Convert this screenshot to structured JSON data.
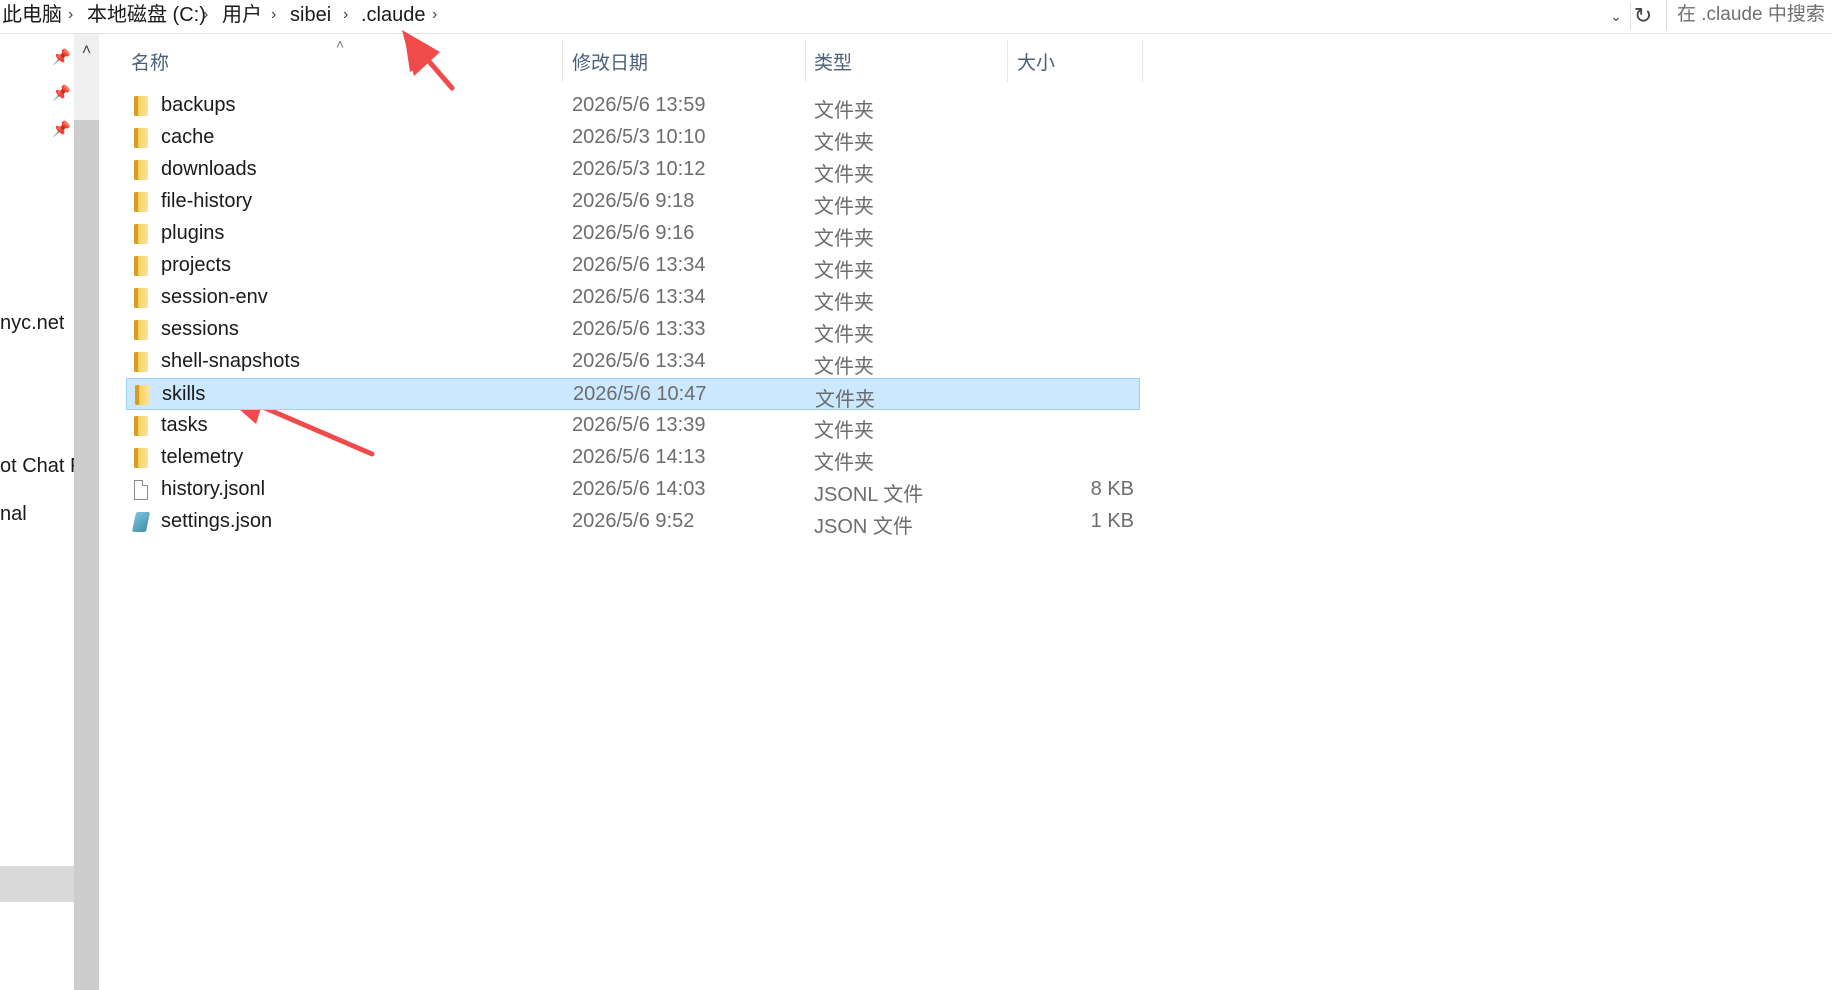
{
  "breadcrumb": {
    "items": [
      "此电脑",
      "本地磁盘 (C:)",
      "用户",
      "sibei",
      ".claude"
    ],
    "separator": "›",
    "trailing_chevron": "›"
  },
  "search": {
    "placeholder": "在 .claude 中搜索"
  },
  "nav": {
    "partial_items": [
      "nyc.net",
      "ot Chat F",
      "nal"
    ]
  },
  "columns": {
    "name": "名称",
    "date": "修改日期",
    "type": "类型",
    "size": "大小"
  },
  "files": [
    {
      "name": "backups",
      "date": "2026/5/6 13:59",
      "type": "文件夹",
      "size": "",
      "icon": "folder-icon"
    },
    {
      "name": "cache",
      "date": "2026/5/3 10:10",
      "type": "文件夹",
      "size": "",
      "icon": "folder-icon"
    },
    {
      "name": "downloads",
      "date": "2026/5/3 10:12",
      "type": "文件夹",
      "size": "",
      "icon": "folder-icon"
    },
    {
      "name": "file-history",
      "date": "2026/5/6 9:18",
      "type": "文件夹",
      "size": "",
      "icon": "folder-icon"
    },
    {
      "name": "plugins",
      "date": "2026/5/6 9:16",
      "type": "文件夹",
      "size": "",
      "icon": "folder-icon"
    },
    {
      "name": "projects",
      "date": "2026/5/6 13:34",
      "type": "文件夹",
      "size": "",
      "icon": "folder-icon"
    },
    {
      "name": "session-env",
      "date": "2026/5/6 13:34",
      "type": "文件夹",
      "size": "",
      "icon": "folder-icon"
    },
    {
      "name": "sessions",
      "date": "2026/5/6 13:33",
      "type": "文件夹",
      "size": "",
      "icon": "folder-icon"
    },
    {
      "name": "shell-snapshots",
      "date": "2026/5/6 13:34",
      "type": "文件夹",
      "size": "",
      "icon": "folder-icon"
    },
    {
      "name": "skills",
      "date": "2026/5/6 10:47",
      "type": "文件夹",
      "size": "",
      "icon": "folder-icon",
      "selected": true
    },
    {
      "name": "tasks",
      "date": "2026/5/6 13:39",
      "type": "文件夹",
      "size": "",
      "icon": "folder-icon"
    },
    {
      "name": "telemetry",
      "date": "2026/5/6 14:13",
      "type": "文件夹",
      "size": "",
      "icon": "folder-icon"
    },
    {
      "name": "history.jsonl",
      "date": "2026/5/6 14:03",
      "type": "JSONL 文件",
      "size": "8 KB",
      "icon": "file-icon"
    },
    {
      "name": "settings.json",
      "date": "2026/5/6 9:52",
      "type": "JSON 文件",
      "size": "1 KB",
      "icon": "json-icon"
    }
  ],
  "colors": {
    "selection_bg": "#cce8ff",
    "selection_border": "#99d1ff",
    "annotation_arrow": "#f04a4a",
    "header_text": "#4c607a"
  }
}
